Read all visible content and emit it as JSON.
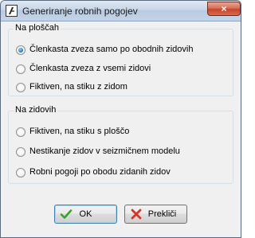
{
  "window": {
    "title": "Generiranje robnih pogojev",
    "close_label": "×"
  },
  "group_surfaces": {
    "title": "Na ploščah",
    "options": [
      {
        "label": "Členkasta zveza samo po obodnih zidovih",
        "checked": true
      },
      {
        "label": "Členkasta zveza z vsemi zidovi",
        "checked": false
      },
      {
        "label": "Fiktiven, na stiku z zidom",
        "checked": false
      }
    ]
  },
  "group_walls": {
    "title": "Na zidovih",
    "options": [
      {
        "label": "Fiktiven, na stiku s ploščo",
        "checked": false
      },
      {
        "label": "Nestikanje zidov v seizmičnem modelu",
        "checked": false
      },
      {
        "label": "Robni pogoji po obodu zidanih zidov",
        "checked": false
      }
    ]
  },
  "buttons": {
    "ok_label": "OK",
    "cancel_label": "Prekliči"
  },
  "colors": {
    "ok_check": "#3aa12f",
    "cancel_x": "#d8322a"
  }
}
